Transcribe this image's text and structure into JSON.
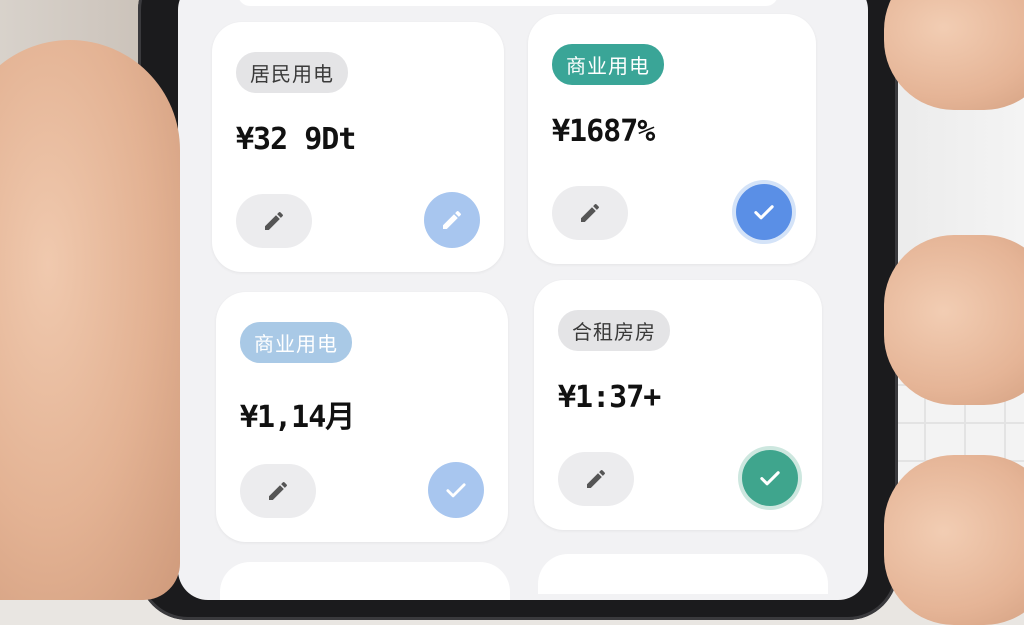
{
  "cards": [
    {
      "tag": "居民用电",
      "amount": "¥32 9Dt",
      "check_state": "light"
    },
    {
      "tag": "商业用电",
      "amount": "¥1687%",
      "check_state": "selected"
    },
    {
      "tag": "商业用电",
      "amount": "¥1,14月",
      "check_state": "light"
    },
    {
      "tag": "合租房房",
      "amount": "¥1:37+",
      "check_state": "selected-teal"
    }
  ],
  "colors": {
    "teal_tag": "#3aa597",
    "blue_tag": "#a9c9e6",
    "check_light": "#a8c6ef",
    "check_blue": "#5a8fe6",
    "check_teal": "#3fa58d"
  },
  "icons": {
    "edit": "pencil-icon",
    "confirm": "checkmark-icon"
  }
}
